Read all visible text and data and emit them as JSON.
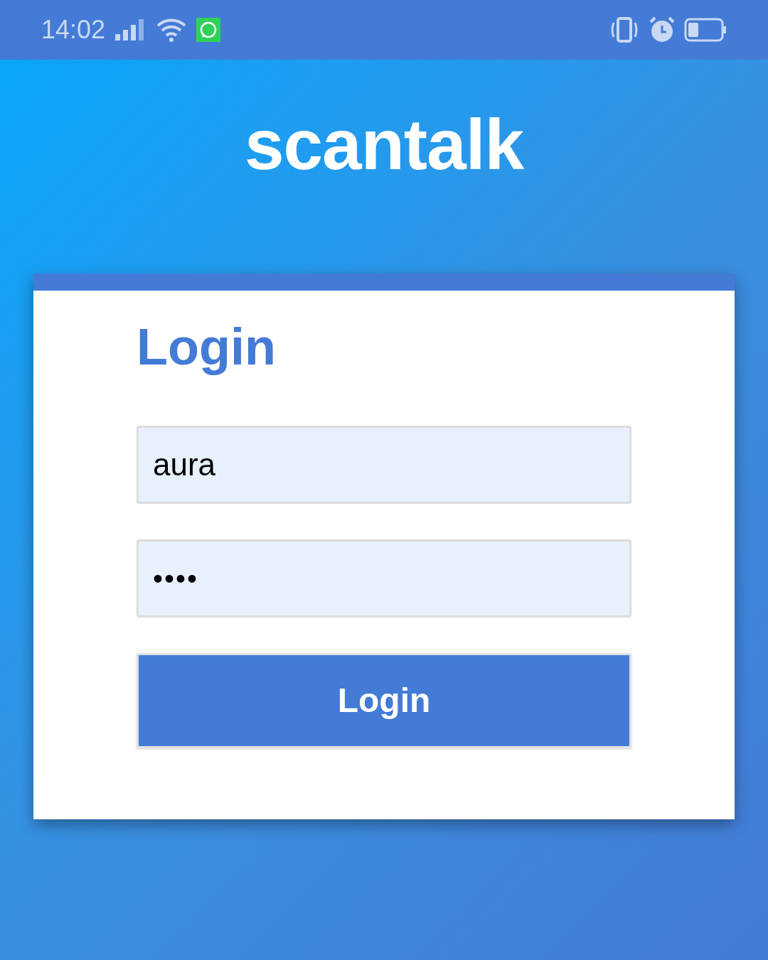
{
  "status_bar": {
    "time": "14:02"
  },
  "app_title": "scantalk",
  "login_card": {
    "heading": "Login",
    "fields": [
      {
        "kind": "text",
        "value": "aura"
      },
      {
        "kind": "password",
        "value": "••••"
      }
    ],
    "button": "Login"
  }
}
